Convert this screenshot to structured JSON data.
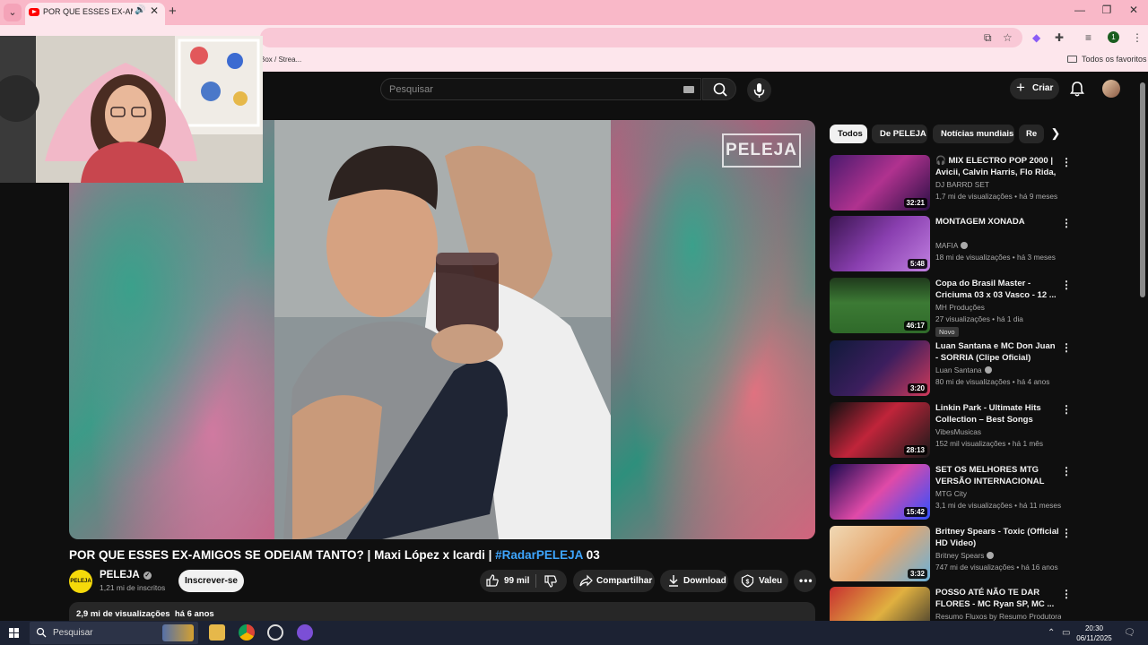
{
  "browser": {
    "tab_title": "POR QUE ESSES EX-AMIGOS SE ODEIAM TANTO? | Maxi López x Icardi | #RadarPELEJA 03",
    "bookmark_partial": "Box / Strea...",
    "bookmark_all": "Todos os favoritos",
    "profile_letter": "1"
  },
  "youtube": {
    "search_placeholder": "Pesquisar",
    "create_label": "Criar",
    "video": {
      "title_main": "POR QUE ESSES EX-AMIGOS SE ODEIAM TANTO? | Maxi López x Icardi | ",
      "title_hashtag": "#RadarPELEJA",
      "title_tail": " 03",
      "watermark": "PELEJA",
      "channel": "PELEJA",
      "channel_avatar_text": "PELEJA",
      "subscribers": "1,21 mi de inscritos",
      "subscribe_label": "Inscrever-se",
      "likes": "99 mil",
      "share_label": "Compartilhar",
      "download_label": "Download",
      "thanks_label": "Valeu",
      "views": "2,9 mi de visualizações",
      "age": "há 6 anos"
    },
    "chips": [
      "Todos",
      "De PELEJA",
      "Notícias mundiais",
      "Re"
    ],
    "recommendations": [
      {
        "title": "🎧 MIX ELECTRO POP 2000 | Avicii, Calvin Harris, Flo Rida, ...",
        "channel": "DJ BARRD SET",
        "verified": false,
        "meta": "1,7 mi de visualizações • há 9 meses",
        "duration": "32:21",
        "badge": ""
      },
      {
        "title": "MONTAGEM XONADA",
        "channel": "MAFIA",
        "verified": true,
        "meta": "18 mi de visualizações • há 3 meses",
        "duration": "5:48",
        "badge": ""
      },
      {
        "title": "Copa do Brasil Master - Criciuma 03 x 03 Vasco - 12 ...",
        "channel": "MH Produções",
        "verified": false,
        "meta": "27 visualizações • há 1 dia",
        "duration": "46:17",
        "badge": "Novo"
      },
      {
        "title": "Luan Santana e MC Don Juan - SORRIA (Clipe Oficial)",
        "channel": "Luan Santana",
        "verified": true,
        "meta": "80 mi de visualizações • há 4 anos",
        "duration": "3:20",
        "badge": ""
      },
      {
        "title": "Linkin Park - Ultimate Hits Collection – Best Songs",
        "channel": "VibesMusicas",
        "verified": false,
        "meta": "152 mil visualizações • há 1 mês",
        "duration": "28:13",
        "badge": ""
      },
      {
        "title": "SET OS MELHORES MTG VERSÃO INTERNACIONAL 202...",
        "channel": "MTG City",
        "verified": false,
        "meta": "3,1 mi de visualizações • há 11 meses",
        "duration": "15:42",
        "badge": ""
      },
      {
        "title": "Britney Spears - Toxic (Official HD Video)",
        "channel": "Britney Spears",
        "verified": true,
        "meta": "747 mi de visualizações • há 16 anos",
        "duration": "3:32",
        "badge": ""
      },
      {
        "title": "POSSO ATÉ NÃO TE DAR FLORES - MC Ryan SP, MC ...",
        "channel": "Resumo Fluxos by Resumo Produtora",
        "verified": false,
        "meta": "",
        "duration": "",
        "badge": ""
      }
    ]
  },
  "taskbar": {
    "search_label": "Pesquisar",
    "time": "20:30",
    "date": "06/11/2025"
  },
  "colors": {
    "browser_frame": "#f9b8c8",
    "yt_bg": "#0f0f0f",
    "hashtag": "#3ea6ff",
    "peleja_yellow": "#f5d90a"
  }
}
